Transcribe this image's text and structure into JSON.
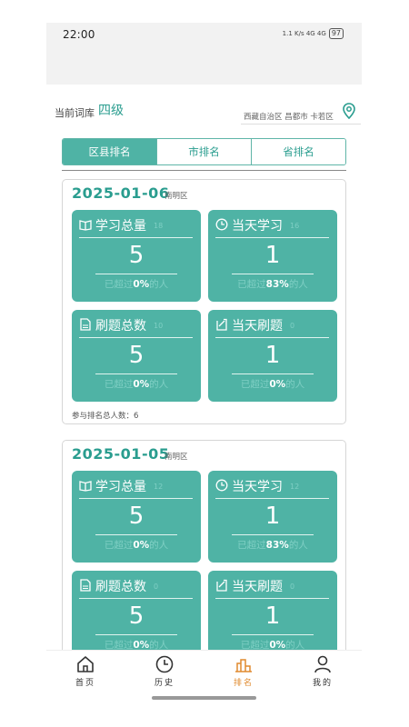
{
  "status": {
    "time": "22:00",
    "signal_text": "1.1 K/s 4G 4G",
    "battery": "97"
  },
  "library": {
    "label": "当前词库",
    "value": "四级"
  },
  "location": {
    "text": "西藏自治区 昌都市 卡若区",
    "icon": "location-pin-icon"
  },
  "tabs": [
    {
      "label": "区县排名",
      "active": true
    },
    {
      "label": "市排名",
      "active": false
    },
    {
      "label": "省排名",
      "active": false
    }
  ],
  "cards": [
    {
      "date": "2025-01-06",
      "district": "南明区",
      "tiles": [
        {
          "title": "学习总量",
          "rank": "18",
          "value": "5",
          "percent": "0%",
          "icon": "book-icon"
        },
        {
          "title": "当天学习",
          "rank": "16",
          "value": "1",
          "percent": "83%",
          "icon": "clock-icon"
        },
        {
          "title": "刷题总数",
          "rank": "10",
          "value": "5",
          "percent": "0%",
          "icon": "document-icon"
        },
        {
          "title": "当天刷题",
          "rank": "0",
          "value": "1",
          "percent": "0%",
          "icon": "edit-icon"
        }
      ],
      "participants_label": "参与排名总人数：",
      "participants_value": "6"
    },
    {
      "date": "2025-01-05",
      "district": "南明区",
      "tiles": [
        {
          "title": "学习总量",
          "rank": "12",
          "value": "5",
          "percent": "0%",
          "icon": "book-icon"
        },
        {
          "title": "当天学习",
          "rank": "12",
          "value": "1",
          "percent": "83%",
          "icon": "clock-icon"
        },
        {
          "title": "刷题总数",
          "rank": "0",
          "value": "5",
          "percent": "0%",
          "icon": "document-icon"
        },
        {
          "title": "当天刷题",
          "rank": "0",
          "value": "1",
          "percent": "0%",
          "icon": "edit-icon"
        }
      ]
    }
  ],
  "foot": {
    "prefix": "已超过",
    "suffix": "的人"
  },
  "nav": [
    {
      "label": "首页",
      "icon": "home-icon",
      "active": false
    },
    {
      "label": "历史",
      "icon": "history-clock-icon",
      "active": false
    },
    {
      "label": "排名",
      "icon": "ranking-icon",
      "active": true
    },
    {
      "label": "我的",
      "icon": "user-icon",
      "active": false
    }
  ],
  "colors": {
    "accent": "#4fb3a5",
    "accent_text": "#2a9d8f",
    "active_nav": "#e08a2e"
  }
}
